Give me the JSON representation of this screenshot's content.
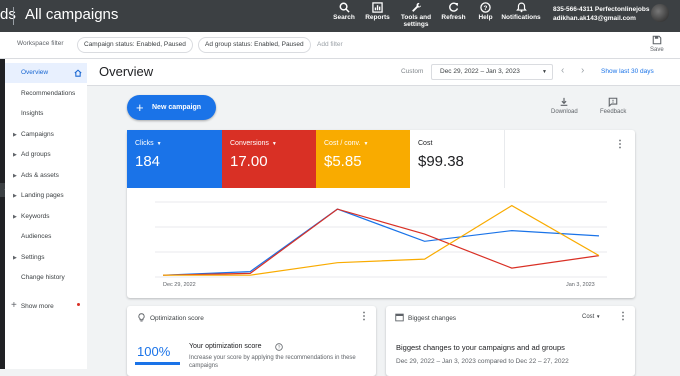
{
  "topbar": {
    "logo_fragment": "ds",
    "title": "All campaigns",
    "items": [
      {
        "label": "Search",
        "icon": "search-icon"
      },
      {
        "label": "Reports",
        "icon": "reports-icon"
      },
      {
        "label": "Tools and settings",
        "label_line1": "Tools and",
        "label_line2": "settings",
        "icon": "wrench-icon"
      },
      {
        "label": "Refresh",
        "icon": "refresh-icon"
      },
      {
        "label": "Help",
        "icon": "help-icon"
      },
      {
        "label": "Notifications",
        "icon": "bell-icon"
      }
    ],
    "account_id": "835-566-4311 Perfectonlinejobs",
    "account_email": "adikhan.ak143@gmail.com"
  },
  "filterbar": {
    "label": "Workspace filter",
    "chips": [
      "Campaign status: Enabled, Paused",
      "Ad group status: Enabled, Paused"
    ],
    "add_filter": "Add filter",
    "save": "Save"
  },
  "sidebar": {
    "items": [
      {
        "label": "Overview",
        "active": true,
        "caret": false
      },
      {
        "label": "Recommendations",
        "active": false,
        "caret": false
      },
      {
        "label": "Insights",
        "active": false,
        "caret": false
      },
      {
        "label": "Campaigns",
        "active": false,
        "caret": true
      },
      {
        "label": "Ad groups",
        "active": false,
        "caret": true
      },
      {
        "label": "Ads & assets",
        "active": false,
        "caret": true
      },
      {
        "label": "Landing pages",
        "active": false,
        "caret": true
      },
      {
        "label": "Keywords",
        "active": false,
        "caret": true
      },
      {
        "label": "Audiences",
        "active": false,
        "caret": false
      },
      {
        "label": "Settings",
        "active": false,
        "caret": true
      },
      {
        "label": "Change history",
        "active": false,
        "caret": false
      }
    ],
    "show_more": "Show more"
  },
  "header": {
    "title": "Overview",
    "custom_label": "Custom",
    "date_range": "Dec 29, 2022 – Jan 3, 2023",
    "show_last": "Show last 30 days"
  },
  "actions": {
    "new_campaign": "New campaign",
    "download": "Download",
    "feedback": "Feedback"
  },
  "metrics": [
    {
      "label": "Clicks",
      "value": "184",
      "bg": "#1a73e8",
      "fg": "#ffffff",
      "dropdown": true
    },
    {
      "label": "Conversions",
      "value": "17.00",
      "bg": "#d93025",
      "fg": "#ffffff",
      "dropdown": true
    },
    {
      "label": "Cost / conv.",
      "value": "$5.85",
      "bg": "#f9ab00",
      "fg": "#ffffff",
      "dropdown": true
    },
    {
      "label": "Cost",
      "value": "$99.38",
      "bg": "#ffffff",
      "fg": "#202124",
      "dropdown": false
    }
  ],
  "chart_data": {
    "type": "line",
    "x_start_label": "Dec 29, 2022",
    "x_end_label": "Jan 3, 2023",
    "grid": "horizontal lines",
    "series": [
      {
        "color": "#1a73e8",
        "values": [
          0.5,
          1.5,
          19,
          10,
          13,
          11.5
        ]
      },
      {
        "color": "#d93025",
        "values": [
          0.5,
          1.0,
          19,
          12,
          2.5,
          6
        ]
      },
      {
        "color": "#f9ab00",
        "values": [
          0.5,
          0.5,
          4,
          5,
          20,
          6
        ]
      }
    ]
  },
  "optimization": {
    "header": "Optimization score",
    "score": "100%",
    "title": "Your optimization score",
    "desc": "Increase your score by applying the recommendations in these campaigns"
  },
  "biggest_changes": {
    "header": "Biggest changes",
    "selector": "Cost",
    "title": "Biggest changes to your campaigns and ad groups",
    "date_text": "Dec 29, 2022 – Jan 3, 2023 compared to Dec 22 – 27, 2022"
  }
}
